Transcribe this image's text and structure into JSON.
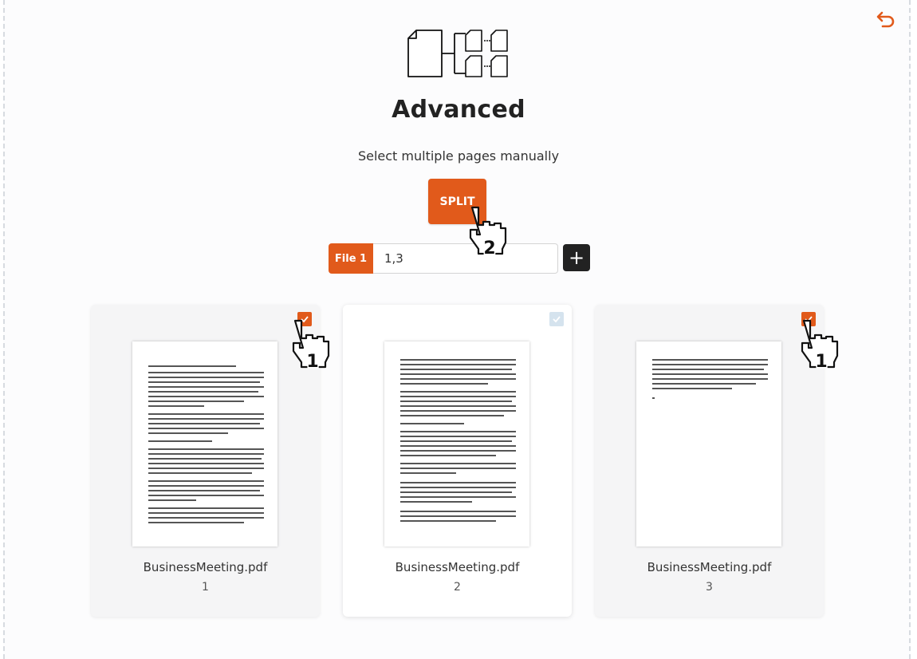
{
  "header": {
    "title": "Advanced",
    "subtitle": "Select multiple pages manually",
    "undo_icon": "undo-icon",
    "hero_icon": "split-document-icon"
  },
  "actions": {
    "split_label": "SPLIT"
  },
  "range": {
    "file_tag": "File 1",
    "value": "1,3",
    "add_label": "+"
  },
  "colors": {
    "accent": "#e15a1b",
    "dark": "#222222",
    "unchecked": "#d5e3ee"
  },
  "annotations": {
    "step_select": "1",
    "step_split": "2"
  },
  "pages": [
    {
      "file_name": "BusinessMeeting.pdf",
      "page_number": "1",
      "selected": true
    },
    {
      "file_name": "BusinessMeeting.pdf",
      "page_number": "2",
      "selected": false
    },
    {
      "file_name": "BusinessMeeting.pdf",
      "page_number": "3",
      "selected": true
    }
  ]
}
